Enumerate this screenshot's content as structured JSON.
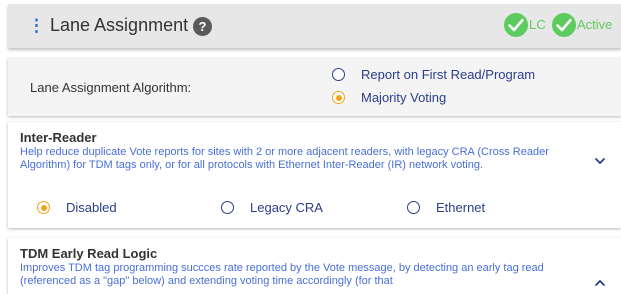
{
  "header": {
    "title": "Lane Assignment",
    "help_glyph": "?",
    "status": [
      {
        "label": "LC",
        "icon": "check-icon",
        "color": "#5ecb5e"
      },
      {
        "label": "Active",
        "icon": "check-icon",
        "color": "#5ecb5e"
      }
    ]
  },
  "algorithm": {
    "label": "Lane Assignment Algorithm:",
    "options": [
      {
        "label": "Report on First Read/Program",
        "selected": false
      },
      {
        "label": "Majority Voting",
        "selected": true
      }
    ]
  },
  "inter_reader": {
    "title": "Inter-Reader",
    "description": "Help reduce duplicate Vote reports for sites with 2 or more adjacent readers, with legacy CRA (Cross Reader Algorithm) for TDM tags only, or for all protocols with Ethernet Inter-Reader (IR) network voting.",
    "options": [
      {
        "label": "Disabled",
        "selected": true
      },
      {
        "label": "Legacy CRA",
        "selected": false
      },
      {
        "label": "Ethernet",
        "selected": false
      }
    ],
    "expand_icon": "chevron-down-icon"
  },
  "tdm_early": {
    "title": "TDM Early Read Logic",
    "description": "Improves TDM tag programming succces rate reported by the Vote message, by detecting an early tag read (referenced as a \"gap\" below) and extending voting time accordingly (for that",
    "collapse_icon": "chevron-up-icon"
  },
  "colors": {
    "accent": "#2a3e8c",
    "link_text": "#4a6fd6",
    "selected_radio": "#f2a21c",
    "status_green": "#5ecb5e"
  }
}
